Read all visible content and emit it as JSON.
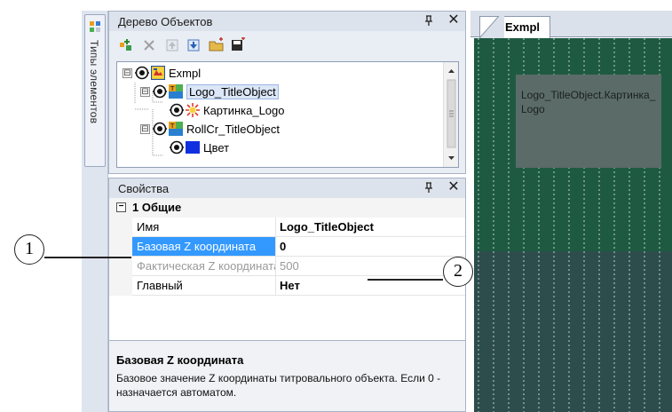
{
  "tool_tab": {
    "label": "Типы элементов",
    "icon": "grid-icon"
  },
  "tree_panel": {
    "title": "Дерево Объектов",
    "pin_label": "ꟼ",
    "close_label": "✕",
    "toolbar": [
      "add-object-icon",
      "delete-icon",
      "move-up-icon",
      "move-down-icon",
      "open-folder-icon",
      "save-icon"
    ],
    "nodes": [
      {
        "label": "Exmpl",
        "level": 0,
        "expander": "⊟",
        "icon": "scene-icon",
        "selected": false
      },
      {
        "label": "Logo_TitleObject",
        "level": 1,
        "expander": "⊟",
        "icon": "title-object-icon",
        "selected": true
      },
      {
        "label": "Картинка_Logo",
        "level": 2,
        "expander": "",
        "icon": "picture-icon",
        "selected": false
      },
      {
        "label": "RollCr_TitleObject",
        "level": 1,
        "expander": "⊟",
        "icon": "title-object-icon",
        "selected": false
      },
      {
        "label": "Цвет",
        "level": 2,
        "expander": "",
        "icon": "color-icon",
        "selected": false
      }
    ]
  },
  "props_panel": {
    "title": "Свойства",
    "pin_label": "ꟼ",
    "close_label": "✕",
    "category": {
      "toggle": "⊟",
      "label": "1 Общие"
    },
    "rows": [
      {
        "name": "Имя",
        "value": "Logo_TitleObject",
        "selected": false,
        "disabled": false
      },
      {
        "name": "Базовая Z координата",
        "value": "0",
        "selected": true,
        "disabled": false
      },
      {
        "name": "Фактическая Z координата",
        "value": "500",
        "selected": false,
        "disabled": true
      },
      {
        "name": "Главный",
        "value": "Нет",
        "selected": false,
        "disabled": false
      }
    ],
    "help": {
      "title": "Базовая Z координата",
      "text": "Базовое значение Z координаты титровального объекта. Если 0 - назначается автоматом."
    }
  },
  "canvas": {
    "tab_label": "Exmpl",
    "object_label": "Logo_TitleObject.Картинка_Logo",
    "colors": {
      "background": "#1e5a42",
      "lower": "#2d4d4d",
      "object": "#5b6b68",
      "selection": "#3399ff"
    }
  },
  "callouts": [
    "1",
    "2"
  ]
}
